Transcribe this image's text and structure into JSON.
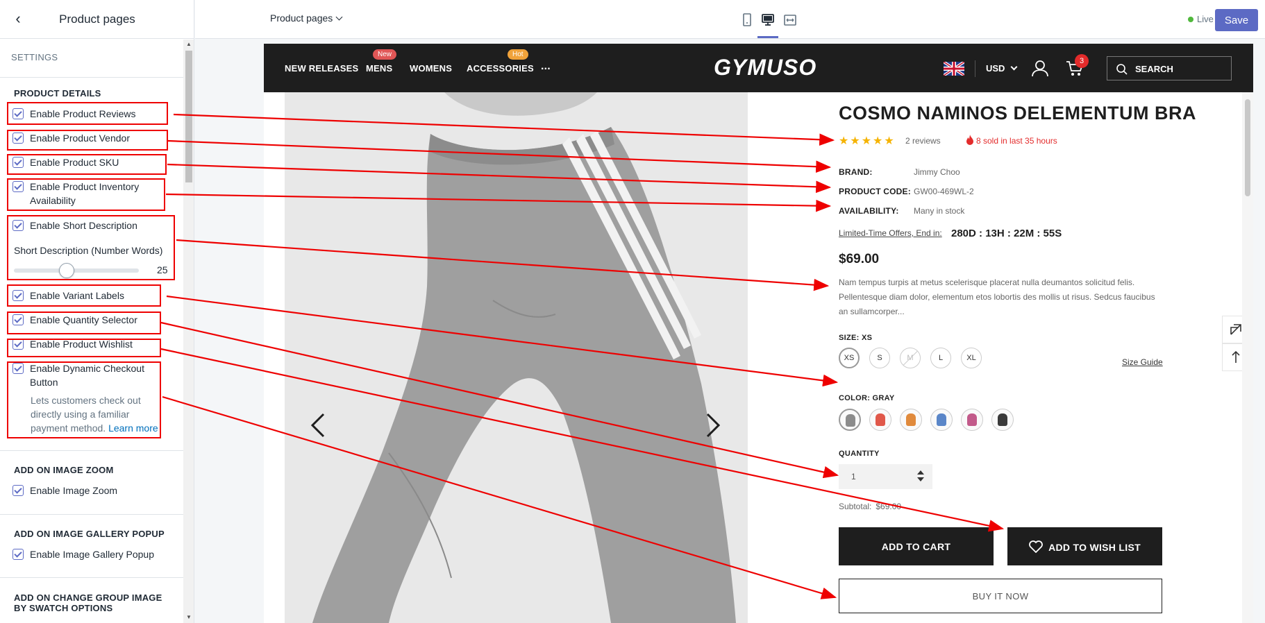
{
  "sidebar": {
    "title": "Product pages",
    "settings_label": "SETTINGS",
    "product_details": {
      "heading": "PRODUCT DETAILS",
      "options": [
        {
          "label": "Enable Product Reviews",
          "checked": true
        },
        {
          "label": "Enable Product Vendor",
          "checked": true
        },
        {
          "label": "Enable Product SKU",
          "checked": true
        },
        {
          "label": "Enable Product Inventory Availability",
          "checked": true
        },
        {
          "label": "Enable Short Description",
          "checked": true
        },
        {
          "label": "Enable Variant Labels",
          "checked": true
        },
        {
          "label": "Enable Quantity Selector",
          "checked": true
        },
        {
          "label": "Enable Product Wishlist",
          "checked": true
        },
        {
          "label": "Enable Dynamic Checkout Button",
          "checked": true
        }
      ],
      "slider": {
        "label": "Short Description (Number Words)",
        "value": "25",
        "fraction": 0.42
      },
      "checkout_help": "Lets customers check out directly using a familiar payment method.",
      "learn_more": "Learn more"
    },
    "image_zoom": {
      "heading": "ADD ON IMAGE ZOOM",
      "option": "Enable Image Zoom"
    },
    "gallery_popup": {
      "heading": "ADD ON IMAGE GALLERY POPUP",
      "option": "Enable Image Gallery Popup"
    },
    "swatch_group": {
      "heading": "ADD ON CHANGE GROUP IMAGE BY SWATCH OPTIONS"
    }
  },
  "topbar": {
    "page_select": "Product pages",
    "status": "Live",
    "save_label": "Save"
  },
  "store": {
    "nav": [
      {
        "label": "NEW RELEASES"
      },
      {
        "label": "MENS",
        "badge": "New"
      },
      {
        "label": "WOMENS"
      },
      {
        "label": "ACCESSORIES",
        "badge": "Hot"
      },
      {
        "label": "..."
      }
    ],
    "logo": "GYMUSO",
    "currency": "USD",
    "cart_count": "3",
    "search_placeholder": "SEARCH"
  },
  "product": {
    "title": "COSMO NAMINOS DELEMENTUM BRA",
    "stars": "★★★★★",
    "rating": 5,
    "reviews": "2 reviews",
    "sold": "8 sold in last 35 hours",
    "brand_label": "BRAND:",
    "brand": "Jimmy Choo",
    "code_label": "PRODUCT CODE:",
    "code": "GW00-469WL-2",
    "availability_label": "AVAILABILITY:",
    "availability": "Many in stock",
    "offer_label": "Limited-Time Offers, End in:",
    "countdown": "280D : 13H : 22M : 55S",
    "price": "$69.00",
    "description": "Nam tempus turpis at metus scelerisque placerat nulla deumantos solicitud felis. Pellentesque diam dolor, elementum etos lobortis des mollis ut risus. Sedcus faucibus an sullamcorper...",
    "size_label": "SIZE: XS",
    "sizes": [
      "XS",
      "S",
      "M",
      "L",
      "XL"
    ],
    "size_guide": "Size Guide",
    "color_label": "COLOR: GRAY",
    "swatch_colors": [
      "#8c8c8c",
      "#e0584a",
      "#e08a3c",
      "#5a86c8",
      "#c25a8a",
      "#3a3a3a"
    ],
    "quantity_label": "QUANTITY",
    "quantity": "1",
    "subtotal_label": "Subtotal:",
    "subtotal": "$69.00",
    "add_to_cart": "ADD TO CART",
    "add_to_wishlist": "ADD TO WISH LIST",
    "buy_now": "BUY IT NOW"
  },
  "colors": {
    "accent": "#5c6ac4",
    "annotation": "#e00000",
    "store_dark": "#1e1e1e",
    "star": "#f5b301",
    "sale_red": "#e32b2b"
  }
}
